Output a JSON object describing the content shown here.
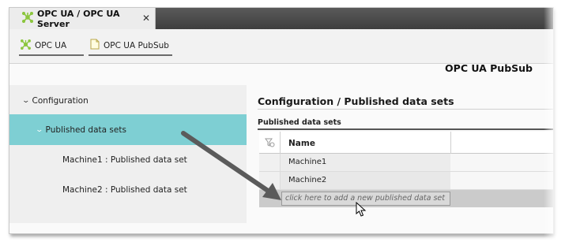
{
  "tab": {
    "title": "OPC UA / OPC UA Server",
    "close_glyph": "✕"
  },
  "toolbar": {
    "opc_ua_label": "OPC UA",
    "pubsub_label": "OPC UA PubSub"
  },
  "page": {
    "title": "OPC UA PubSub"
  },
  "nav": {
    "items": [
      {
        "label": "Configuration"
      },
      {
        "label": "Published data sets"
      },
      {
        "label": "Machine1 : Published data set"
      },
      {
        "label": "Machine2 : Published data set"
      }
    ]
  },
  "section": {
    "title": "Configuration / Published data sets"
  },
  "grid": {
    "caption": "Published data sets",
    "column_name": "Name",
    "rows": [
      {
        "name": "Machine1"
      },
      {
        "name": "Machine2"
      }
    ],
    "add_placeholder": "click here to add a new published data set"
  },
  "colors": {
    "accent": "#7ecfd3",
    "icon_green": "#8cc63f",
    "arrow": "#5b5b5b"
  },
  "icons": {
    "opc": "network-node-icon",
    "document": "document-icon",
    "filter": "filter-icon",
    "chevron": "chevron-down-icon"
  }
}
